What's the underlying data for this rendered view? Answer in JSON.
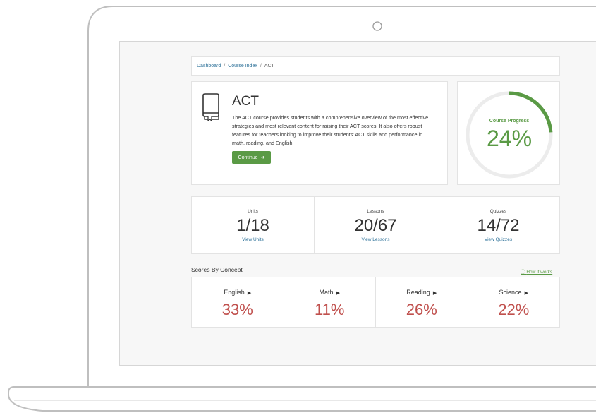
{
  "breadcrumb": {
    "items": [
      "Dashboard",
      "Course Index"
    ],
    "current": "ACT"
  },
  "course": {
    "title": "ACT",
    "description": "The ACT course provides students with a comprehensive overview of the most effective strategies and most relevant content for raising their ACT scores. It also offers robust features for teachers looking to improve their students' ACT skills and performance in math, reading, and English.",
    "continue_label": "Continue"
  },
  "progress": {
    "label": "Course Progress",
    "value_text": "24%",
    "fraction": 0.24,
    "color": "#5a9a45"
  },
  "stats": [
    {
      "label": "Units",
      "value": "1/18",
      "link": "View Units"
    },
    {
      "label": "Lessons",
      "value": "20/67",
      "link": "View Lessons"
    },
    {
      "label": "Quizzes",
      "value": "14/72",
      "link": "View Quizzes"
    }
  ],
  "scores_section": {
    "title": "Scores By Concept",
    "help_link": "How it works"
  },
  "scores": [
    {
      "label": "English",
      "value": "33%"
    },
    {
      "label": "Math",
      "value": "11%"
    },
    {
      "label": "Reading",
      "value": "26%"
    },
    {
      "label": "Science",
      "value": "22%"
    }
  ],
  "colors": {
    "accent": "#5a9a45",
    "score": "#c0504d",
    "link": "#2a6f97"
  }
}
